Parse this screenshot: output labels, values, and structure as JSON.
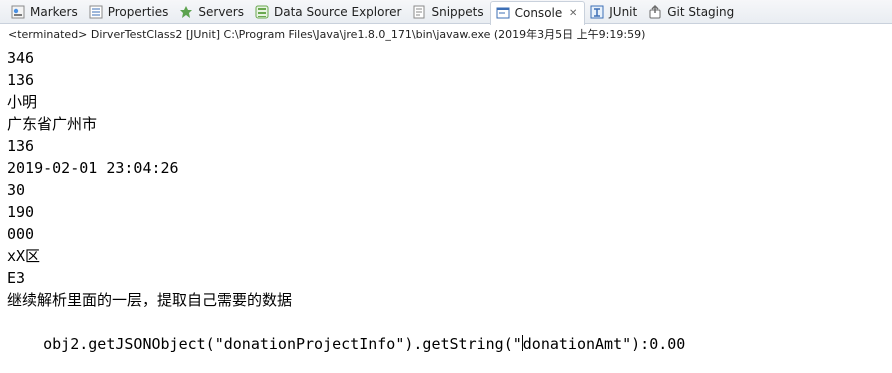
{
  "tabs": [
    {
      "label": "Markers",
      "icon": "markers-icon",
      "active": false
    },
    {
      "label": "Properties",
      "icon": "properties-icon",
      "active": false
    },
    {
      "label": "Servers",
      "icon": "servers-icon",
      "active": false
    },
    {
      "label": "Data Source Explorer",
      "icon": "data-source-explorer-icon",
      "active": false
    },
    {
      "label": "Snippets",
      "icon": "snippets-icon",
      "active": false
    },
    {
      "label": "Console",
      "icon": "console-icon",
      "active": true,
      "close": "✕"
    },
    {
      "label": "JUnit",
      "icon": "junit-icon",
      "active": false
    },
    {
      "label": "Git Staging",
      "icon": "git-staging-icon",
      "active": false
    }
  ],
  "console": {
    "subtitle": "<terminated> DirverTestClass2 [JUnit] C:\\Program Files\\Java\\jre1.8.0_171\\bin\\javaw.exe (2019年3月5日 上午9:19:59)",
    "lines": [
      "346",
      "136",
      "小明",
      "广东省广州市",
      "136",
      "2019-02-01 23:04:26",
      "30",
      "190",
      "000",
      "xX区",
      "E3",
      "继续解析里面的一层，提取自己需要的数据"
    ],
    "last_line_before_cursor": "obj2.getJSONObject(\"donationProjectInfo\").getString(\"",
    "last_line_after_cursor": "donationAmt\"):0.00"
  },
  "colors": {
    "tabbar_bg": "#eef2f6",
    "active_tab_bg": "#ffffff",
    "text": "#000000"
  }
}
